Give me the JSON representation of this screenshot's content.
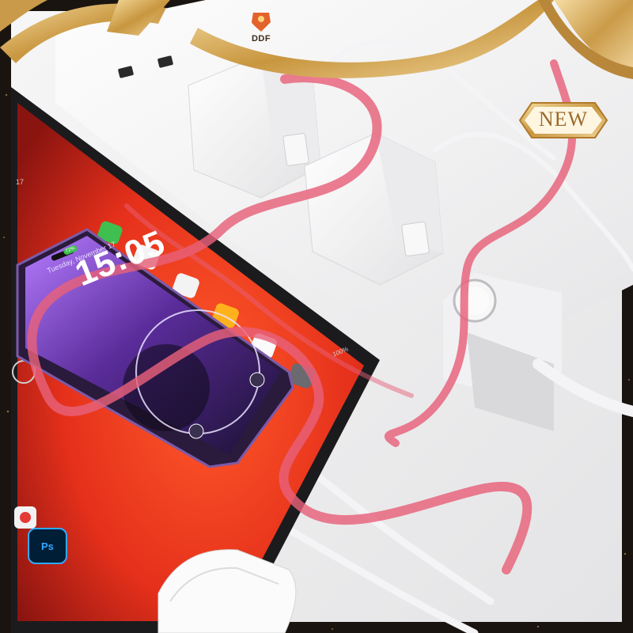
{
  "brand": {
    "name": "DDF",
    "logo_icon": "shield-logo-icon"
  },
  "badge": {
    "label": "NEW",
    "color": "#d8b06a"
  },
  "phone": {
    "lock_time": "15:05",
    "lock_date": "Tuesday, November 17",
    "battery": "72%"
  },
  "tablet": {
    "status_bar": "100%",
    "time_fragment": "17",
    "app_icon_label": "Ps"
  },
  "colors": {
    "ribbon": "#e8617a",
    "gold_frame": "#d9b36c",
    "tablet_screen": "#e8301c",
    "charger": "#f4f4f4",
    "background": "#1a1410"
  }
}
